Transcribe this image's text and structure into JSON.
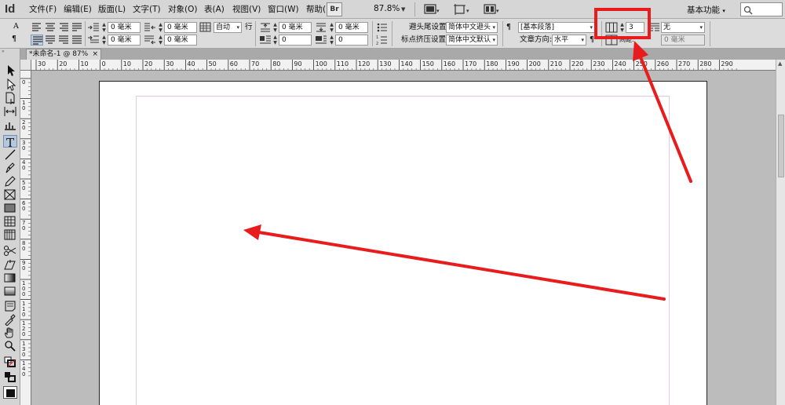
{
  "app": {
    "logo": "Id",
    "menus": [
      "文件(F)",
      "编辑(E)",
      "版面(L)",
      "文字(T)",
      "对象(O)",
      "表(A)",
      "视图(V)",
      "窗口(W)",
      "帮助(H)"
    ],
    "bridge_button": "Br",
    "zoom_level": "87.8%",
    "workspace": "基本功能"
  },
  "control_panel": {
    "indent_left": "0 毫米",
    "indent_first": "0 毫米",
    "indent_right": "0 毫米",
    "indent_last": "0 毫米",
    "leading": "自动",
    "leading_unit": "行",
    "space_before": "0 毫米",
    "space_after": "0 毫米",
    "drop_lines": "0",
    "drop_chars": "0",
    "space_before2": "0 毫米",
    "space_after2": "0 毫米",
    "kinsoku_label": "避头尾设置:",
    "kinsoku_value": "简体中文避头",
    "mojikumi_label": "标点挤压设置:",
    "mojikumi_value": "简体中文默认",
    "paragraph_style": "[基本段落]",
    "direction_label": "文章方向:",
    "direction_value": "水平",
    "columns": "3",
    "span_value": "无",
    "gutter_label": "间距:",
    "gutter_value": "0 毫米"
  },
  "document": {
    "tab_title": "*未命名-1 @ 87%",
    "close": "×"
  },
  "ruler": {
    "h_labels": [
      "30",
      "20",
      "10",
      "0",
      "10",
      "20",
      "30",
      "40",
      "50",
      "60",
      "70",
      "80",
      "90",
      "100",
      "110",
      "120",
      "130",
      "140",
      "150",
      "160",
      "170",
      "180",
      "190",
      "200",
      "210",
      "220",
      "230",
      "240",
      "250",
      "260",
      "270",
      "280",
      "290"
    ],
    "v_labels": [
      "0",
      "1 0",
      "2 0",
      "3 0",
      "4 0",
      "5 0",
      "6 0",
      "7 0",
      "8 0",
      "9 0",
      "1 0 0",
      "1 1 0",
      "1 2 0",
      "1 3 0",
      "1 4 0"
    ]
  },
  "colors": {
    "annotation": "#e81c1c",
    "chrome": "#d6d6d6",
    "pasteboard": "#bcbcbc"
  }
}
